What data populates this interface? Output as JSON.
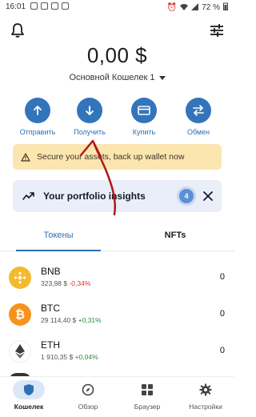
{
  "status_bar": {
    "time": "16:01",
    "battery": "72 %"
  },
  "header": {
    "balance": "0,00 $",
    "wallet_name": "Основной Кошелек 1"
  },
  "actions": [
    {
      "label": "Отправить",
      "icon": "arrow-up-icon"
    },
    {
      "label": "Получить",
      "icon": "arrow-down-icon"
    },
    {
      "label": "Купить",
      "icon": "card-icon"
    },
    {
      "label": "Обмен",
      "icon": "swap-icon"
    }
  ],
  "warning": {
    "text": "Secure your assets, back up wallet now"
  },
  "insights": {
    "text": "Your portfolio insights",
    "badge": "4"
  },
  "tabs": {
    "tokens": "Токены",
    "nfts": "NFTs"
  },
  "assets": [
    {
      "symbol": "BNB",
      "price": "323,98 $",
      "change": "-0,34%",
      "amount": "0",
      "color": "#f3ba2f"
    },
    {
      "symbol": "BTC",
      "price": "29 114,40 $",
      "change": "+0,31%",
      "amount": "0",
      "color": "#f7931a"
    },
    {
      "symbol": "ETH",
      "price": "1 910,35 $",
      "change": "+0,04%",
      "amount": "0",
      "color": "#ffffff"
    }
  ],
  "bottom_nav": [
    {
      "label": "Кошелек",
      "icon": "shield-icon",
      "active": true
    },
    {
      "label": "Обзор",
      "icon": "compass-icon",
      "active": false
    },
    {
      "label": "Браузер",
      "icon": "grid-icon",
      "active": false
    },
    {
      "label": "Настройки",
      "icon": "gear-icon",
      "active": false
    }
  ],
  "colors": {
    "accent": "#3375bb",
    "warning_bg": "#fbe6b0",
    "insights_bg": "#e9eef8",
    "annotation": "#b01818"
  }
}
